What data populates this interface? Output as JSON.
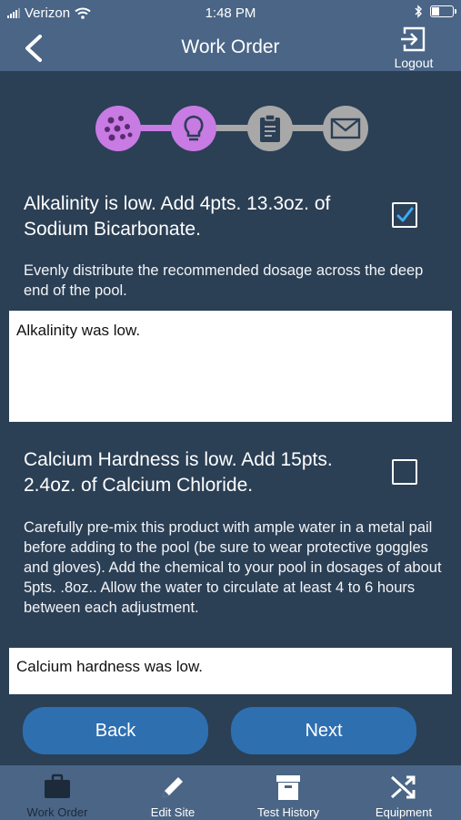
{
  "status_bar": {
    "carrier": "Verizon",
    "time": "1:48 PM"
  },
  "nav": {
    "title": "Work Order",
    "logout_label": "Logout"
  },
  "stepper": {
    "steps": [
      {
        "icon": "dots-icon",
        "color": "#c77be3"
      },
      {
        "icon": "lightbulb-icon",
        "color": "#c77be3"
      },
      {
        "icon": "clipboard-icon",
        "color": "#a8a8a8"
      },
      {
        "icon": "envelope-icon",
        "color": "#a8a8a8"
      }
    ]
  },
  "tasks": [
    {
      "title": "Alkalinity is low. Add 4pts. 13.3oz. of Sodium Bicarbonate.",
      "checked": true,
      "description": "Evenly distribute the recommended dosage across the deep end of the pool.",
      "note": "Alkalinity was low."
    },
    {
      "title": "Calcium Hardness is low. Add 15pts. 2.4oz. of Calcium Chloride.",
      "checked": false,
      "description": "Carefully pre-mix this product with ample water in a metal pail before adding to the pool (be sure to wear protective goggles and gloves).  Add the chemical to your pool in dosages of about 5pts. .8oz..  Allow the water to circulate at least 4 to 6 hours between each adjustment.",
      "note": "Calcium hardness was low."
    }
  ],
  "buttons": {
    "back": "Back",
    "next": "Next"
  },
  "tabs": [
    {
      "label": "Work Order",
      "icon": "briefcase-icon",
      "active": true
    },
    {
      "label": "Edit Site",
      "icon": "pencil-icon",
      "active": false
    },
    {
      "label": "Test History",
      "icon": "archive-box-icon",
      "active": false
    },
    {
      "label": "Equipment",
      "icon": "shuffle-icon",
      "active": false
    }
  ],
  "colors": {
    "background": "#2b3f55",
    "bar": "#4a6586",
    "accent_purple": "#c77be3",
    "button": "#2e6fb0",
    "check": "#3fa9f5"
  }
}
